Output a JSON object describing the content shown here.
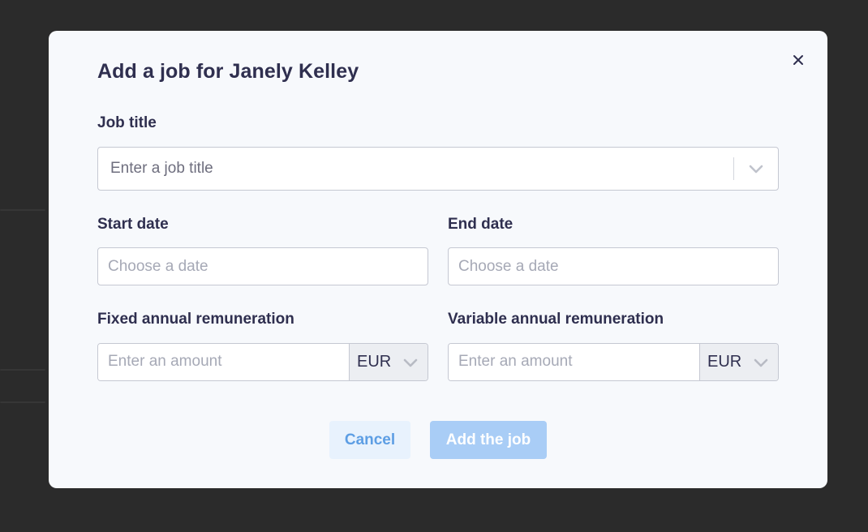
{
  "modal": {
    "title": "Add a job for Janely Kelley",
    "close_icon": "close-icon"
  },
  "job_title": {
    "label": "Job title",
    "placeholder": "Enter a job title",
    "dropdown_icon": "chevron-down-icon"
  },
  "start_date": {
    "label": "Start date",
    "placeholder": "Choose a date"
  },
  "end_date": {
    "label": "End date",
    "placeholder": "Choose a date"
  },
  "fixed_remuneration": {
    "label": "Fixed annual remuneration",
    "placeholder": "Enter an amount",
    "currency": "EUR"
  },
  "variable_remuneration": {
    "label": "Variable annual remuneration",
    "placeholder": "Enter an amount",
    "currency": "EUR"
  },
  "actions": {
    "cancel_label": "Cancel",
    "add_label": "Add the job"
  },
  "colors": {
    "backdrop": "#2b2b2b",
    "modal_bg": "#f7f9fc",
    "text_dark": "#2f2f4f",
    "accent": "#5d9ee4",
    "primary_disabled": "#a9cdf6"
  }
}
